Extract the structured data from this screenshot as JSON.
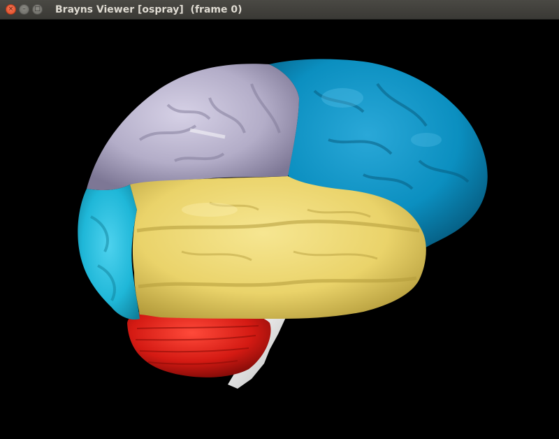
{
  "window": {
    "title": "Brayns Viewer [ospray]  (frame 0)",
    "controls": {
      "close_glyph": "×",
      "minimize_glyph": "–",
      "maximize_glyph": "□"
    }
  },
  "viewport": {
    "background": "#000000",
    "scene": "3d-brain-model",
    "regions": {
      "parietal_lobe": "#b3adc8",
      "frontal_lobe": "#0b8fc0",
      "occipital_lobe": "#1fb7d8",
      "temporal_lobe": "#ead36a",
      "cerebellum": "#d41a13",
      "brain_stem": "#eaeaea"
    }
  }
}
